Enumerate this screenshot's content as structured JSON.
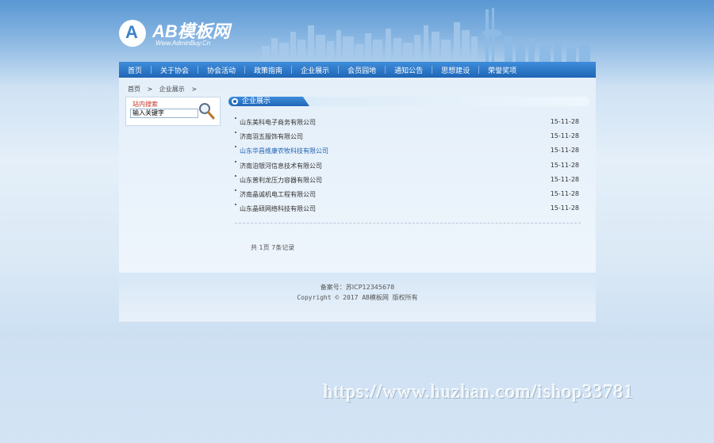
{
  "logo": {
    "mark": "A",
    "name": "AB模板网",
    "subtitle": "Www.AdminBuy.Cn"
  },
  "nav": {
    "items": [
      "首页",
      "关于协会",
      "协会活动",
      "政策指南",
      "企业展示",
      "会员园地",
      "通知公告",
      "思想建设",
      "荣誉奖项"
    ]
  },
  "breadcrumb": {
    "home": "首页",
    "sep1": ">",
    "current": "企业展示",
    "sep2": ">"
  },
  "search": {
    "title": "站内搜索",
    "input_value": "输入关键字"
  },
  "section": {
    "title": "企业展示"
  },
  "list": [
    {
      "name": "山东美科电子商务有限公司",
      "date": "15-11-28"
    },
    {
      "name": "济南羽五服饰有限公司",
      "date": "15-11-28"
    },
    {
      "name": "山东华昌维康农牧科技有限公司",
      "date": "15-11-28"
    },
    {
      "name": "济南泊银河信息技术有限公司",
      "date": "15-11-28"
    },
    {
      "name": "山东普利龙压力容器有限公司",
      "date": "15-11-28"
    },
    {
      "name": "济南晶诚机电工程有限公司",
      "date": "15-11-28"
    },
    {
      "name": "山东晶硕网络科技有限公司",
      "date": "15-11-28"
    }
  ],
  "pager": {
    "text": "共 1页 7条记录"
  },
  "footer": {
    "icp": "备案号：苏ICP12345678",
    "copyright": "Copyright © 2017 AB模板网 版权所有"
  },
  "watermark": {
    "text": "https://www.huzhan.com/ishop33781"
  },
  "colors": {
    "nav_bg": "#2a78c8",
    "active_link": "#1e63b3",
    "search_title": "#c0392b"
  }
}
